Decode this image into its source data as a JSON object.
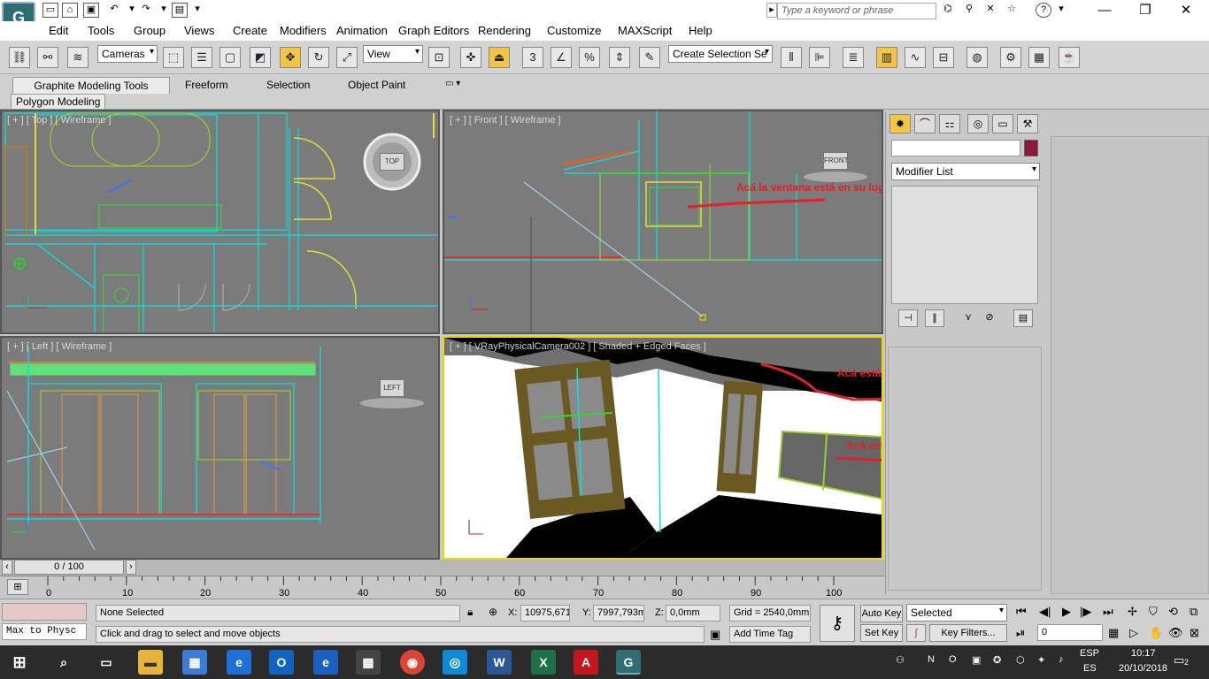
{
  "app": {
    "logo": "G",
    "search_placeholder": "Type a keyword or phrase"
  },
  "menu": [
    "Edit",
    "Tools",
    "Group",
    "Views",
    "Create",
    "Modifiers",
    "Animation",
    "Graph Editors",
    "Rendering",
    "Customize",
    "MAXScript",
    "Help"
  ],
  "toolbar": {
    "filter_dropdown": "Cameras",
    "refcoord_dropdown": "View",
    "selection_set_dropdown": "Create Selection Se",
    "snap_label": "3"
  },
  "ribbon": {
    "tabs": [
      "Graphite Modeling Tools",
      "Freeform",
      "Selection",
      "Object Paint"
    ],
    "subtab": "Polygon Modeling"
  },
  "viewports": {
    "top": {
      "label": "[ + ] [ Top ] [ Wireframe ]",
      "cube": "TOP"
    },
    "front": {
      "label": "[ + ] [ Front ] [ Wireframe ]",
      "cube": "FRONT",
      "annotation": "Acá la ventana está en su lugar"
    },
    "left": {
      "label": "[ + ] [ Left ] [ Wireframe ]",
      "cube": "LEFT"
    },
    "camera": {
      "label": "[ + ] [ VRayPhysicalCamera002 ] [ Shaded + Edged Faces ]",
      "annotation_floor": "Acá está el piso",
      "annotation_window": "Acá está la ventana"
    }
  },
  "command_panel": {
    "modifier_list": "Modifier List",
    "color_swatch": "#8b1a3a"
  },
  "timeline": {
    "frame_display": "0 / 100",
    "ticks": [
      "0",
      "10",
      "20",
      "30",
      "40",
      "50",
      "60",
      "70",
      "80",
      "90",
      "100"
    ]
  },
  "status": {
    "maxscript": "Max to Physc",
    "selection": "None Selected",
    "prompt": "Click and drag to select and move objects",
    "x_label": "X:",
    "x_value": "10975,671",
    "y_label": "Y:",
    "y_value": "7997,793m",
    "z_label": "Z:",
    "z_value": "0,0mm",
    "grid": "Grid = 2540,0mm",
    "add_time_tag": "Add Time Tag",
    "auto_key": "Auto Key",
    "set_key": "Set Key",
    "selected_dropdown": "Selected",
    "key_filters": "Key Filters...",
    "frame_field": "0"
  },
  "taskbar": {
    "lang_top": "ESP",
    "lang_bottom": "ES",
    "time": "10:17",
    "date": "20/10/2018",
    "notifications": "2"
  }
}
